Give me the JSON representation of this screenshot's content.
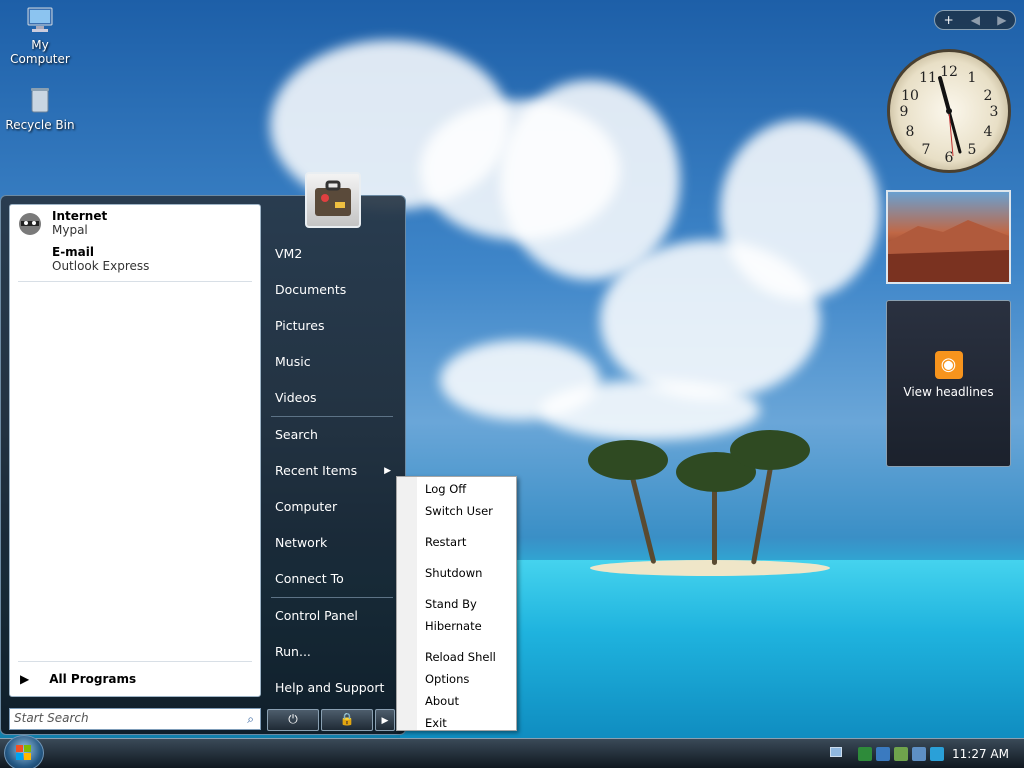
{
  "desktop": {
    "icons": [
      {
        "label": "My Computer"
      },
      {
        "label": "Recycle Bin"
      }
    ]
  },
  "start_menu": {
    "pinned": [
      {
        "title": "Internet",
        "subtitle": "Mypal"
      },
      {
        "title": "E-mail",
        "subtitle": "Outlook Express"
      }
    ],
    "all_programs": "All Programs",
    "search_placeholder": "Start Search",
    "right_items": [
      "VM2",
      "Documents",
      "Pictures",
      "Music",
      "Videos",
      "Search",
      "Recent Items",
      "Computer",
      "Network",
      "Connect To",
      "Control Panel",
      "Run...",
      "Help and Support"
    ]
  },
  "power_menu": {
    "items": [
      "Log Off",
      "Switch User",
      "Restart",
      "Shutdown",
      "Stand By",
      "Hibernate",
      "Reload Shell",
      "Options",
      "About",
      "Exit"
    ]
  },
  "sidebar": {
    "feed_label": "View headlines"
  },
  "taskbar": {
    "clock": "11:27 AM"
  },
  "colors": {
    "rss": "#f7941d",
    "start_menu_bg": "#1f2c38"
  }
}
